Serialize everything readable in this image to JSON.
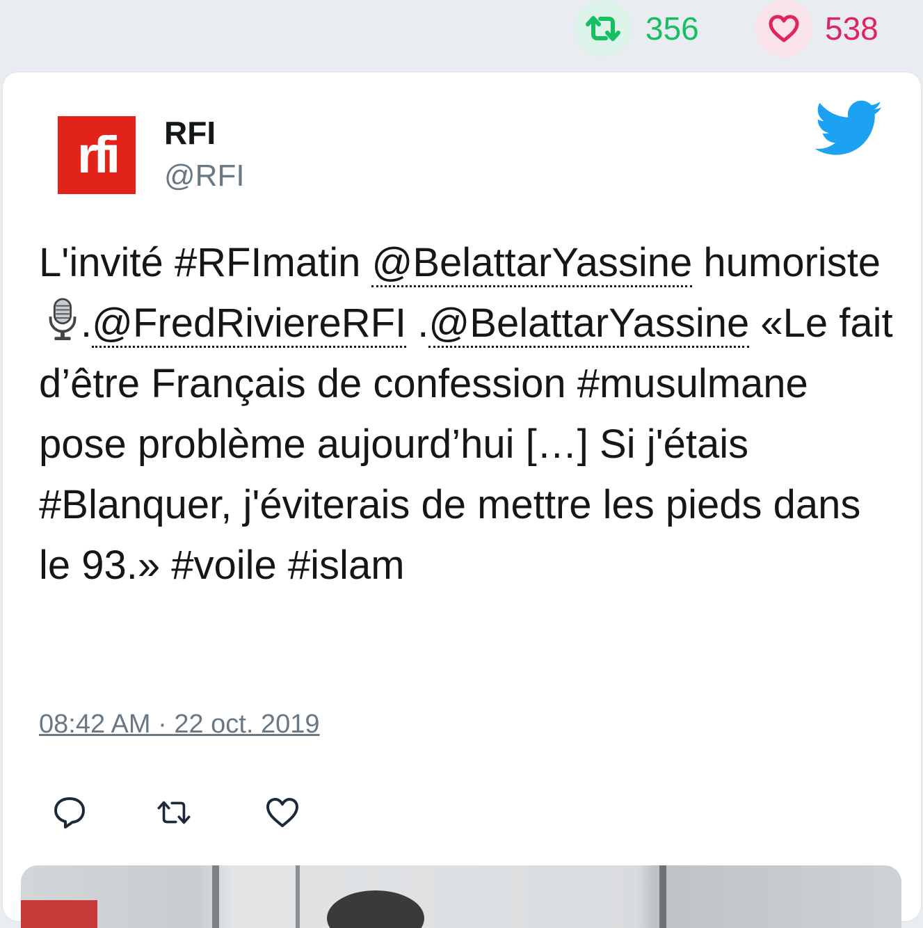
{
  "top_stats": {
    "retweet_count": "356",
    "like_count": "538"
  },
  "tweet": {
    "author_name": "RFI",
    "author_handle": "@RFI",
    "avatar_text": "rfi",
    "text": {
      "part1": "L'invité #RFImatin ",
      "mention1": "@BelattarYassine",
      "part2": " humoriste ",
      "part3": ".",
      "mention2": "@FredRiviereRFI",
      "part4": " .",
      "mention3": "@BelattarYassine",
      "part5": " «Le fait d’être Français de confession #musulmane pose problème aujourd’hui […] Si j'étais #Blanquer, j'éviterais de mettre les pieds dans le 93.» #voile #islam"
    },
    "timestamp": "08:42 AM · 22 oct. 2019"
  },
  "icons": {
    "retweet": "retweet-icon",
    "like": "heart-icon",
    "reply": "reply-icon",
    "twitter": "twitter-bird-icon",
    "microphone": "microphone-icon"
  },
  "colors": {
    "retweet": "#17bf63",
    "like": "#e0245e",
    "twitter_blue": "#1da1f2",
    "rfi_red": "#e2231a"
  }
}
